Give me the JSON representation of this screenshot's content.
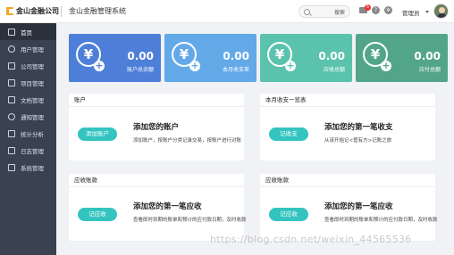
{
  "header": {
    "logo_text": "金山金融公司",
    "system_title": "金山金融管理系统",
    "search_button": "搜索",
    "notification_count": "5",
    "user_name": "管理员"
  },
  "sidebar": {
    "items": [
      {
        "label": "首页",
        "icon": "home-icon",
        "active": true
      },
      {
        "label": "用户管理",
        "icon": "user-icon"
      },
      {
        "label": "公司管理",
        "icon": "company-icon"
      },
      {
        "label": "项目管理",
        "icon": "project-icon"
      },
      {
        "label": "文档管理",
        "icon": "document-icon"
      },
      {
        "label": "通知管理",
        "icon": "notification-icon"
      },
      {
        "label": "统计分析",
        "icon": "statistics-icon"
      },
      {
        "label": "日志管理",
        "icon": "log-icon"
      },
      {
        "label": "系统管理",
        "icon": "system-icon"
      }
    ]
  },
  "stats": [
    {
      "amount": "0.00",
      "label": "账户总余额",
      "color": "#4e7fd8"
    },
    {
      "amount": "0.00",
      "label": "本月收支差",
      "color": "#63a9e8"
    },
    {
      "amount": "0.00",
      "label": "应收总额",
      "color": "#5bc3ad"
    },
    {
      "amount": "0.00",
      "label": "应付总额",
      "color": "#53a58a"
    }
  ],
  "cards": [
    {
      "title": "账户",
      "button": "添加账户",
      "heading": "添加您的账户",
      "desc": "添加账户，按账户分类记录交易，按账户进行对账"
    },
    {
      "title": "本月收支一览表",
      "button": "记收支",
      "heading": "添加您的第一笔收支",
      "desc": "从该开始记<管有方>记账之旅"
    },
    {
      "title": "应收账款",
      "button": "记应收",
      "heading": "添加您的第一笔应收",
      "desc": "查看即时到期的账单和预计的应付款日期，及时收款"
    },
    {
      "title": "应收账款",
      "button": "记应收",
      "heading": "添加您的第一笔应收",
      "desc": "查看即时到期的账单和预计的应付款日期，及时收款"
    }
  ],
  "watermark": "https://blog.csdn.net/weixin_44565536",
  "colors": {
    "sidebar": "#3a4150",
    "accent_button": "#34c4bf"
  }
}
